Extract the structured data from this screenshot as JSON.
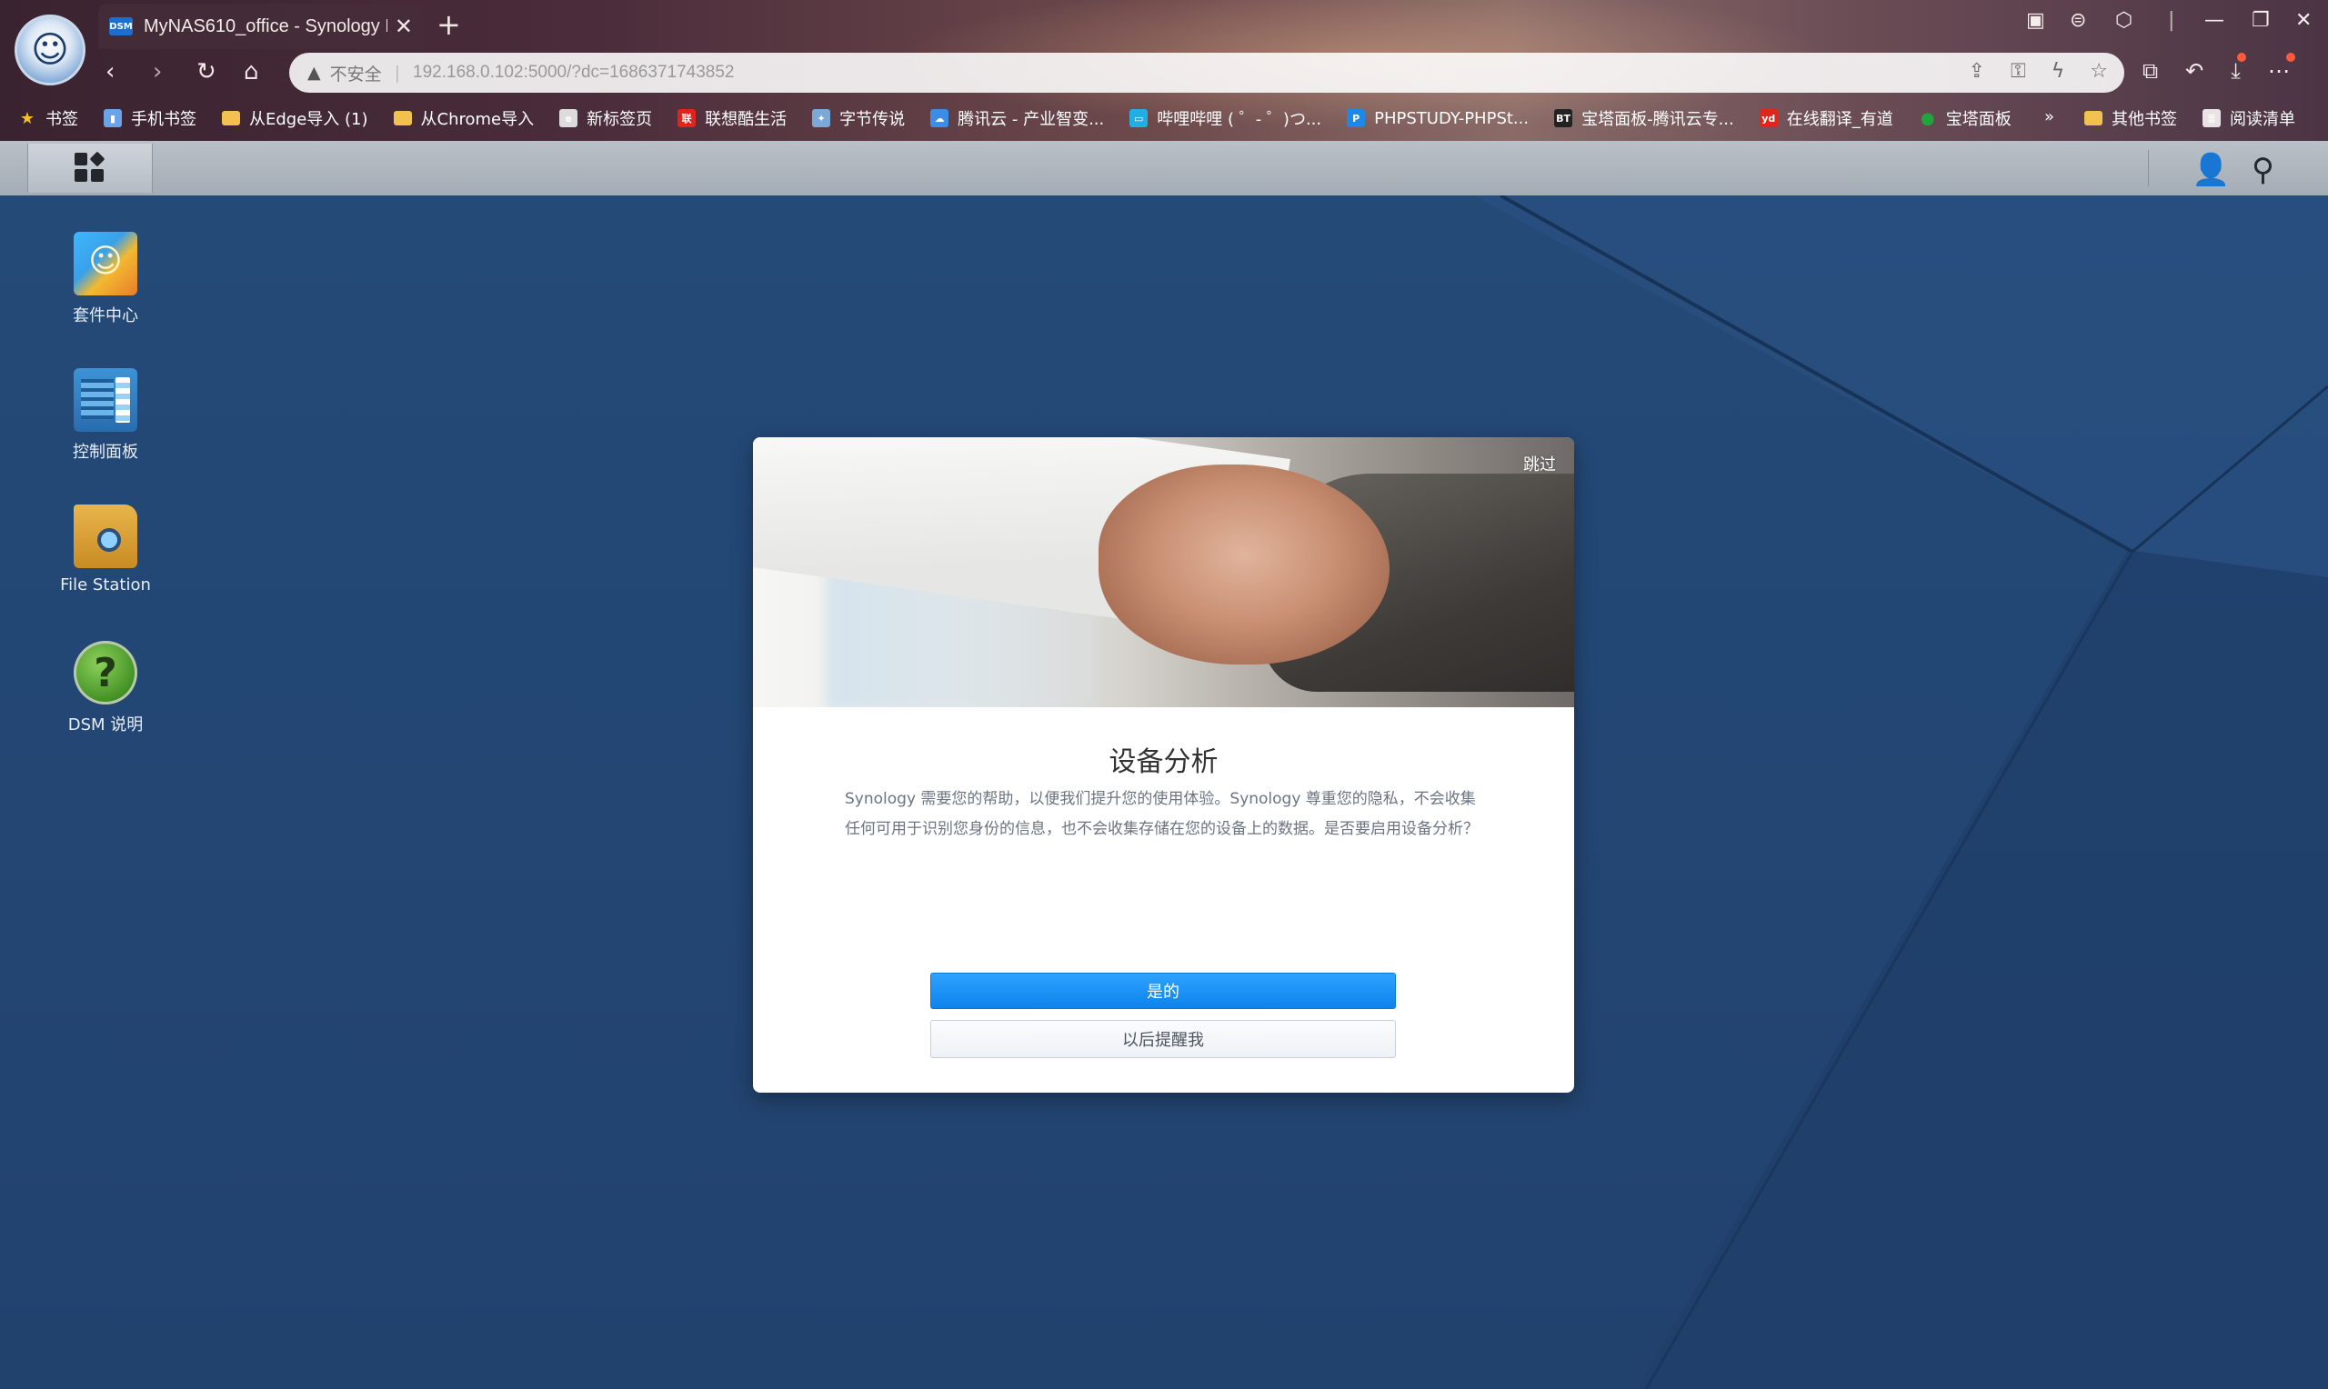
{
  "browser": {
    "tab": {
      "favicon": "DSM",
      "title": "MyNAS610_office - Synology DiskStation"
    },
    "address": {
      "security_label": "不安全",
      "url": "192.168.0.102:5000/?dc=1686371743852"
    },
    "bookmarks": [
      {
        "label": "书签",
        "icon": "star-icon",
        "color": "#f5c026"
      },
      {
        "label": "手机书签",
        "icon": "phone-icon",
        "color": "#6aa3e8"
      },
      {
        "label": "从Edge导入 (1)",
        "icon": "folder-icon",
        "color": "#f2c14e"
      },
      {
        "label": "从Chrome导入",
        "icon": "folder-icon",
        "color": "#f2c14e"
      },
      {
        "label": "新标签页",
        "icon": "edge-icon",
        "color": "#dcdcdc"
      },
      {
        "label": "联想酷生活",
        "icon": "lenovo-icon",
        "color": "#e2231a"
      },
      {
        "label": "字节传说",
        "icon": "byte-icon",
        "color": "#7aa9d8"
      },
      {
        "label": "腾讯云 - 产业智变...",
        "icon": "cloud-icon",
        "color": "#3c8de6"
      },
      {
        "label": "哔哩哔哩 ( ゜- ゜)つ...",
        "icon": "bilibili-icon",
        "color": "#23ade5"
      },
      {
        "label": "PHPSTUDY-PHPSt...",
        "icon": "p-icon",
        "color": "#1e88e5"
      },
      {
        "label": "宝塔面板-腾讯云专...",
        "icon": "bt-icon",
        "color": "#222222"
      },
      {
        "label": "在线翻译_有道",
        "icon": "youdao-icon",
        "color": "#e1251b"
      },
      {
        "label": "宝塔面板",
        "icon": "bt-green-icon",
        "color": "#20a53a"
      }
    ],
    "bookmarks_right": [
      {
        "label": "其他书签",
        "icon": "folder-icon",
        "color": "#f2c14e"
      },
      {
        "label": "阅读清单",
        "icon": "reading-list-icon",
        "color": "#e9e4e4"
      }
    ]
  },
  "desktop": {
    "icons": [
      {
        "label": "套件中心",
        "icon": "package-center-icon"
      },
      {
        "label": "控制面板",
        "icon": "control-panel-icon"
      },
      {
        "label": "File Station",
        "icon": "file-station-icon"
      },
      {
        "label": "DSM 说明",
        "icon": "dsm-help-icon"
      }
    ]
  },
  "dialog": {
    "skip_label": "跳过",
    "title": "设备分析",
    "body": "Synology 需要您的帮助，以便我们提升您的使用体验。Synology 尊重您的隐私，不会收集任何可用于识别您身份的信息，也不会收集存储在您的设备上的数据。是否要启用设备分析？",
    "yes_label": "是的",
    "later_label": "以后提醒我"
  }
}
